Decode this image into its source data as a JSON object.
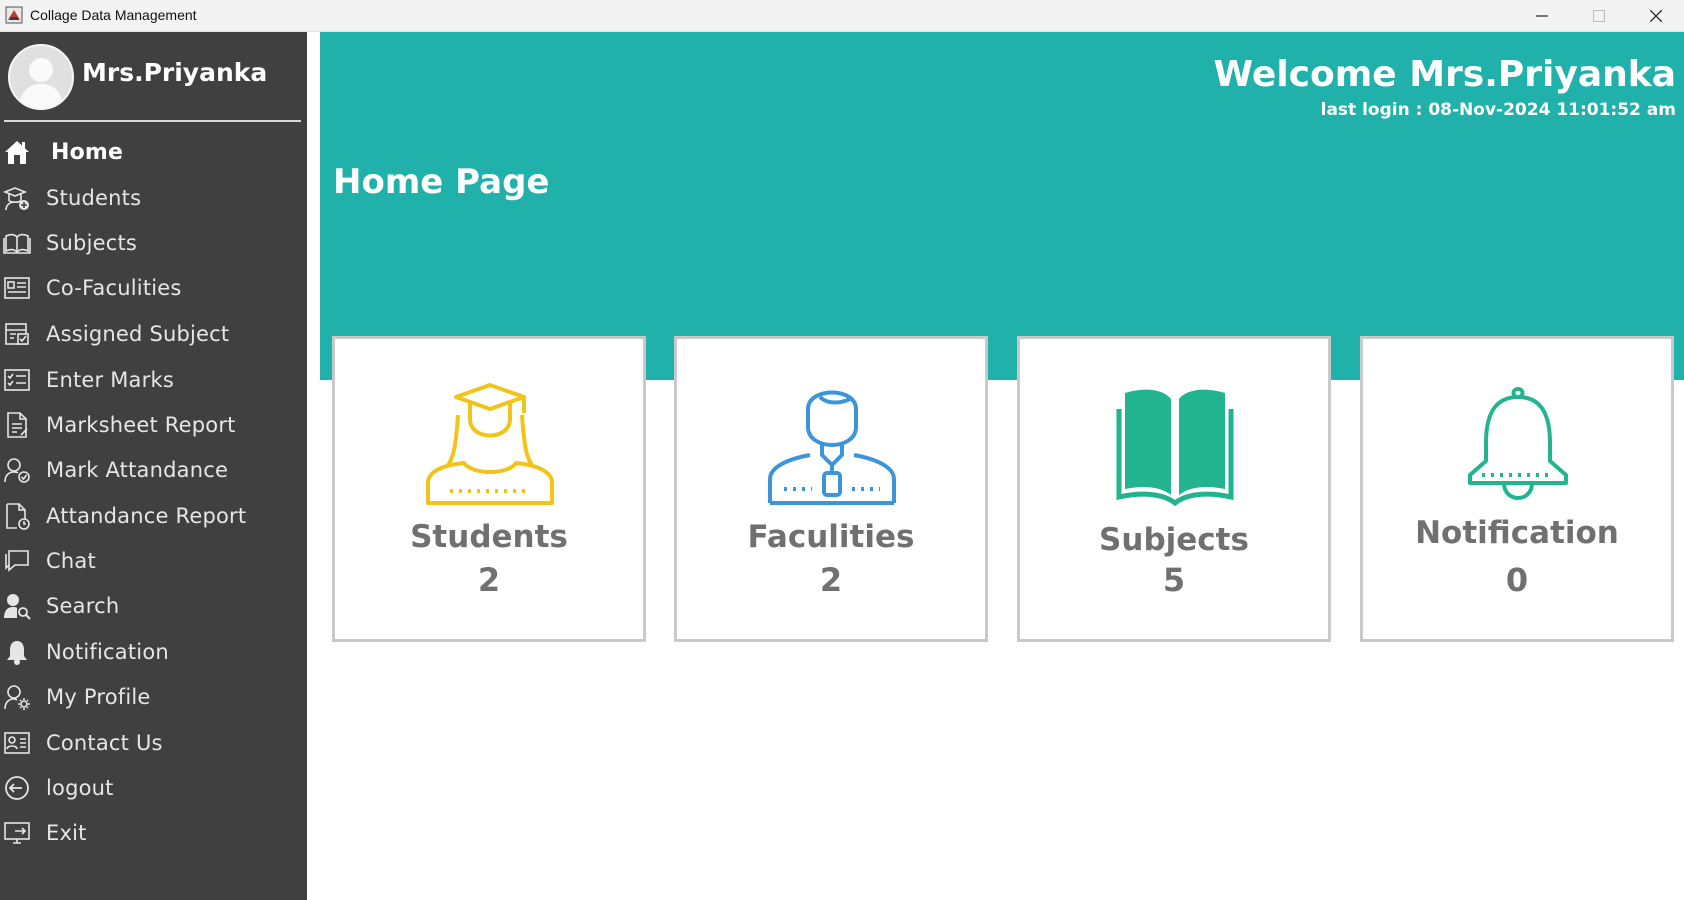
{
  "window": {
    "title": "Collage Data Management"
  },
  "sidebar": {
    "user_name": "Mrs.Priyanka",
    "items": [
      {
        "label": "Home",
        "icon": "home-icon"
      },
      {
        "label": "Students",
        "icon": "students-icon"
      },
      {
        "label": "Subjects",
        "icon": "book-icon"
      },
      {
        "label": "Co-Faculities",
        "icon": "id-list-icon"
      },
      {
        "label": "Assigned Subject",
        "icon": "assign-icon"
      },
      {
        "label": "Enter Marks",
        "icon": "marks-icon"
      },
      {
        "label": "Marksheet Report",
        "icon": "report-icon"
      },
      {
        "label": "Mark Attandance",
        "icon": "user-check-icon"
      },
      {
        "label": "Attandance Report",
        "icon": "document-clock-icon"
      },
      {
        "label": "Chat",
        "icon": "chat-icon"
      },
      {
        "label": "Search",
        "icon": "user-search-icon"
      },
      {
        "label": "Notification",
        "icon": "bell-icon"
      },
      {
        "label": "My Profile",
        "icon": "user-gear-icon"
      },
      {
        "label": "Contact Us",
        "icon": "contact-card-icon"
      },
      {
        "label": "logout",
        "icon": "logout-icon"
      },
      {
        "label": "Exit",
        "icon": "exit-icon"
      }
    ]
  },
  "header": {
    "welcome": "Welcome Mrs.Priyanka",
    "last_login": "last login : 08-Nov-2024 11:01:52 am",
    "page_title": "Home Page"
  },
  "cards": [
    {
      "label": "Students",
      "count": "2",
      "icon": "graduate-icon",
      "color": "#f2c318"
    },
    {
      "label": "Faculities",
      "count": "2",
      "icon": "faculty-icon",
      "color": "#3c95d8"
    },
    {
      "label": "Subjects",
      "count": "5",
      "icon": "open-book-icon",
      "color": "#22b38f"
    },
    {
      "label": "Notification",
      "count": "0",
      "icon": "bell-icon",
      "color": "#22b38f"
    }
  ],
  "colors": {
    "sidebar_bg": "#404040",
    "header_bg": "#20b2aa",
    "card_text": "#707070"
  }
}
